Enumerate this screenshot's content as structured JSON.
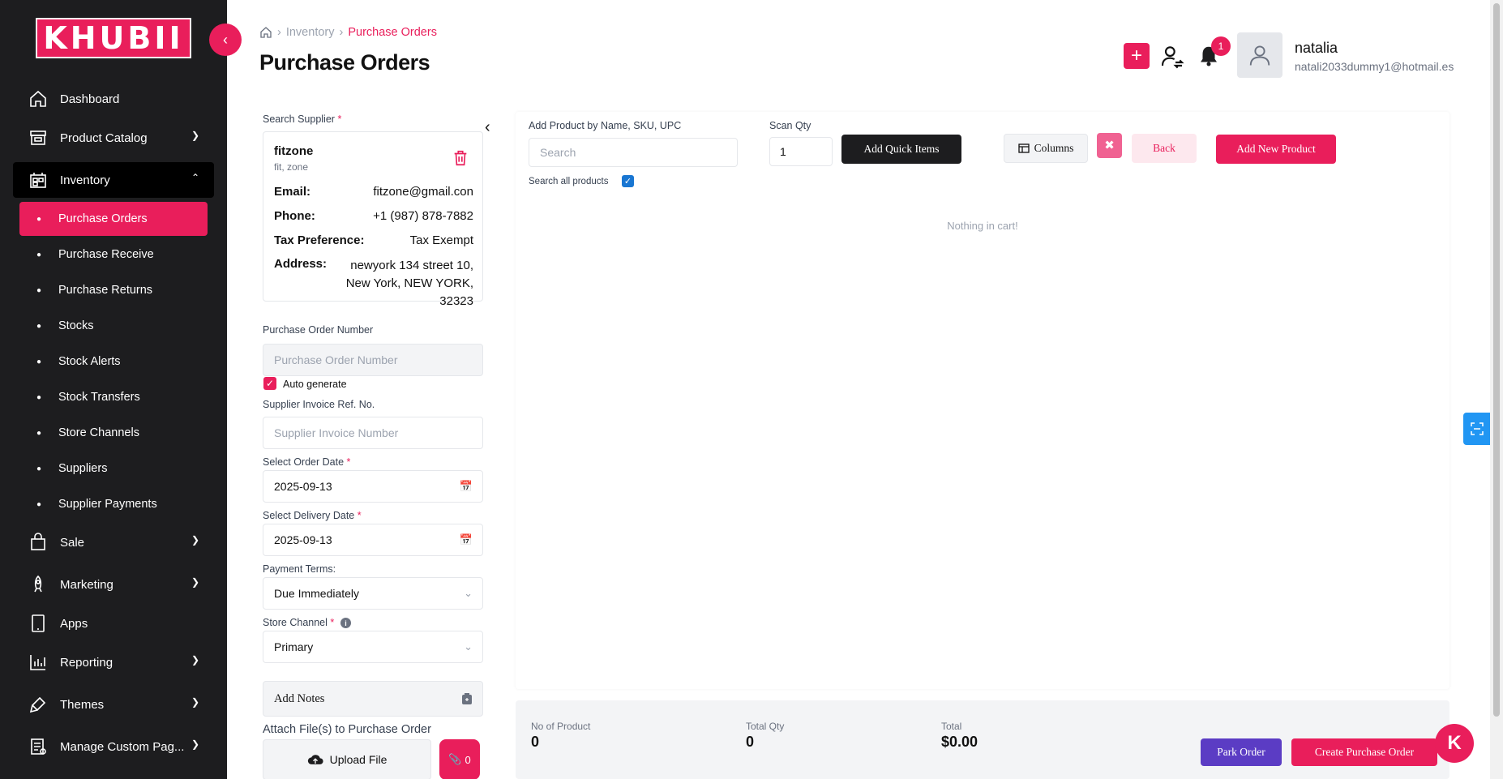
{
  "brand": {
    "logo_text": "KHUBII"
  },
  "sidebar": {
    "items": [
      {
        "label": "Dashboard",
        "icon": "home-icon"
      },
      {
        "label": "Product Catalog",
        "icon": "store-icon"
      },
      {
        "label": "Inventory",
        "icon": "inventory-icon"
      },
      {
        "label": "Sale",
        "icon": "bag-icon"
      },
      {
        "label": "Marketing",
        "icon": "rocket-icon"
      },
      {
        "label": "Apps",
        "icon": "tablet-icon"
      },
      {
        "label": "Reporting",
        "icon": "chart-icon"
      },
      {
        "label": "Themes",
        "icon": "brush-icon"
      },
      {
        "label": "Manage Custom Pag...",
        "icon": "page-icon"
      }
    ],
    "inventory_sub": [
      "Purchase Orders",
      "Purchase Receive",
      "Purchase Returns",
      "Stocks",
      "Stock Alerts",
      "Stock Transfers",
      "Store Channels",
      "Suppliers",
      "Supplier Payments"
    ]
  },
  "header": {
    "breadcrumb": [
      "Inventory",
      "Purchase Orders"
    ],
    "title": "Purchase Orders",
    "notification_count": "1",
    "user_name": "natalia",
    "user_email": "natali2033dummy1@hotmail.es"
  },
  "form": {
    "search_supplier_label": "Search Supplier",
    "supplier": {
      "name": "fitzone",
      "sub": "fit, zone",
      "email_label": "Email:",
      "email": "fitzone@gmail.con",
      "phone_label": "Phone:",
      "phone": "+1 (987) 878-7882",
      "tax_label": "Tax Preference:",
      "tax": "Tax Exempt",
      "address_label": "Address:",
      "address": "newyork 134 street 10, New York, NEW YORK, 32323"
    },
    "po_number_label": "Purchase Order Number",
    "po_number_placeholder": "Purchase Order Number",
    "auto_generate_label": "Auto generate",
    "invoice_label": "Supplier Invoice Ref. No.",
    "invoice_placeholder": "Supplier Invoice Number",
    "order_date_label": "Select Order Date",
    "order_date": "2025-09-13",
    "delivery_date_label": "Select Delivery Date",
    "delivery_date": "2025-09-13",
    "payment_terms_label": "Payment Terms:",
    "payment_terms": "Due Immediately",
    "store_channel_label": "Store Channel",
    "store_channel": "Primary",
    "notes_label": "Add Notes",
    "attach_label": "Attach File(s) to Purchase Order",
    "upload_label": "Upload File",
    "attach_count": "0"
  },
  "main": {
    "add_product_label": "Add Product by Name, SKU, UPC",
    "search_placeholder": "Search",
    "search_all_label": "Search all products",
    "scan_qty_label": "Scan Qty",
    "scan_qty": "1",
    "add_quick_label": "Add Quick Items",
    "columns_label": "Columns",
    "back_label": "Back",
    "add_new_label": "Add New Product",
    "empty_message": "Nothing in cart!"
  },
  "totals": {
    "no_of_product_label": "No of Product",
    "no_of_product": "0",
    "total_qty_label": "Total Qty",
    "total_qty": "0",
    "total_label": "Total",
    "total": "$0.00",
    "park_label": "Park Order",
    "create_label": "Create Purchase Order"
  },
  "colors": {
    "accent": "#e91e5b",
    "sidebar": "#1d1d1f",
    "purple": "#5b3cc4",
    "blue": "#2196f3"
  }
}
